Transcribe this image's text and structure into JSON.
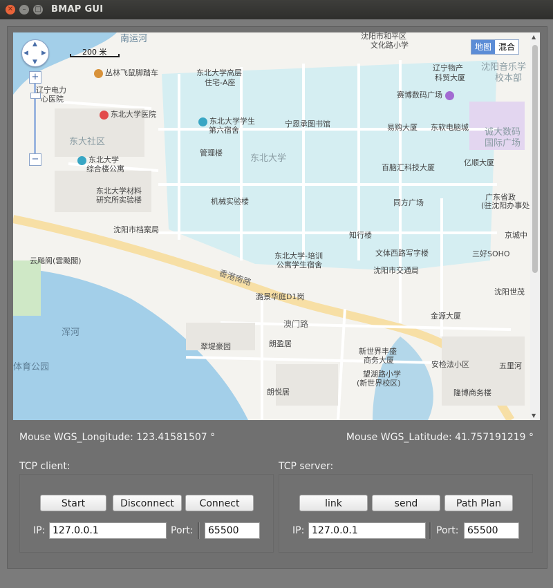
{
  "window": {
    "title": "BMAP GUI"
  },
  "map": {
    "scale_label": "200 米",
    "maptype": [
      "地图",
      "混合"
    ],
    "places": [
      {
        "text": "南运河",
        "cls": "water"
      },
      {
        "text": "丛林飞鼠脚踏车",
        "cls": ""
      },
      {
        "text": "辽宁电力",
        "cls": ""
      },
      {
        "text": "心医院",
        "cls": ""
      },
      {
        "text": "东北大学高层",
        "cls": ""
      },
      {
        "text": "住宅-A座",
        "cls": ""
      },
      {
        "text": "沈阳市和平区",
        "cls": ""
      },
      {
        "text": "文化路小学",
        "cls": ""
      },
      {
        "text": "辽宁物产",
        "cls": ""
      },
      {
        "text": "科贸大厦",
        "cls": ""
      },
      {
        "text": "沈阳音乐学",
        "cls": "big"
      },
      {
        "text": "校本部",
        "cls": "big"
      },
      {
        "text": "赛博数码广场",
        "cls": ""
      },
      {
        "text": "东北大学医院",
        "cls": ""
      },
      {
        "text": "东北大学学生",
        "cls": ""
      },
      {
        "text": "第六宿舍",
        "cls": ""
      },
      {
        "text": "宁恩承图书馆",
        "cls": ""
      },
      {
        "text": "易购大厦",
        "cls": ""
      },
      {
        "text": "东软电脑城",
        "cls": ""
      },
      {
        "text": "诚大数码",
        "cls": "big"
      },
      {
        "text": "国际广场",
        "cls": "big"
      },
      {
        "text": "东大社区",
        "cls": "big"
      },
      {
        "text": "管理楼",
        "cls": ""
      },
      {
        "text": "东北大学",
        "cls": "big"
      },
      {
        "text": "百脑汇科技大厦",
        "cls": ""
      },
      {
        "text": "亿顺大厦",
        "cls": ""
      },
      {
        "text": "东北大学",
        "cls": ""
      },
      {
        "text": "综合楼公寓",
        "cls": ""
      },
      {
        "text": "东北大学材料",
        "cls": ""
      },
      {
        "text": "研究所实验楼",
        "cls": ""
      },
      {
        "text": "机械实验楼",
        "cls": ""
      },
      {
        "text": "广东省政",
        "cls": ""
      },
      {
        "text": "(驻沈阳办事处",
        "cls": ""
      },
      {
        "text": "同方广场",
        "cls": ""
      },
      {
        "text": "沈阳市档案局",
        "cls": ""
      },
      {
        "text": "知行楼",
        "cls": ""
      },
      {
        "text": "京城中",
        "cls": ""
      },
      {
        "text": "云飚阁(雲飈閣)",
        "cls": ""
      },
      {
        "text": "东北大学-培训",
        "cls": ""
      },
      {
        "text": "公寓学生宿舍",
        "cls": ""
      },
      {
        "text": "文体西路写字楼",
        "cls": ""
      },
      {
        "text": "三好SOHO",
        "cls": ""
      },
      {
        "text": "沈阳市交通局",
        "cls": ""
      },
      {
        "text": "沈阳世茂",
        "cls": ""
      },
      {
        "text": "香港南路",
        "cls": "road"
      },
      {
        "text": "潞景华庭D1岗",
        "cls": ""
      },
      {
        "text": "金源大厦",
        "cls": ""
      },
      {
        "text": "澳门路",
        "cls": "road"
      },
      {
        "text": "浑河",
        "cls": "water"
      },
      {
        "text": "翠堤豪园",
        "cls": ""
      },
      {
        "text": "朗盈居",
        "cls": ""
      },
      {
        "text": "新世界丰盛",
        "cls": ""
      },
      {
        "text": "商务大厦",
        "cls": ""
      },
      {
        "text": "安检法小区",
        "cls": ""
      },
      {
        "text": "五里河",
        "cls": ""
      },
      {
        "text": "体育公园",
        "cls": "water"
      },
      {
        "text": "望湖路小学",
        "cls": ""
      },
      {
        "text": "(新世界校区)",
        "cls": ""
      },
      {
        "text": "朗悦居",
        "cls": ""
      },
      {
        "text": "隆博商务楼",
        "cls": ""
      }
    ]
  },
  "status": {
    "longitude_label": "Mouse WGS_Longitude: 123.41581507 °",
    "latitude_label": "Mouse WGS_Latitude: 41.757191219 °"
  },
  "client": {
    "title": "TCP client:",
    "buttons": [
      "Start",
      "Disconnect",
      "Connect"
    ],
    "ip_label": "IP:",
    "ip_value": "127.0.0.1",
    "port_label": "Port:",
    "port_value": "65500"
  },
  "server": {
    "title": "TCP server:",
    "buttons": [
      "link",
      "send",
      "Path Plan"
    ],
    "ip_label": "IP:",
    "ip_value": "127.0.0.1",
    "port_label": "Port:",
    "port_value": "65500"
  }
}
